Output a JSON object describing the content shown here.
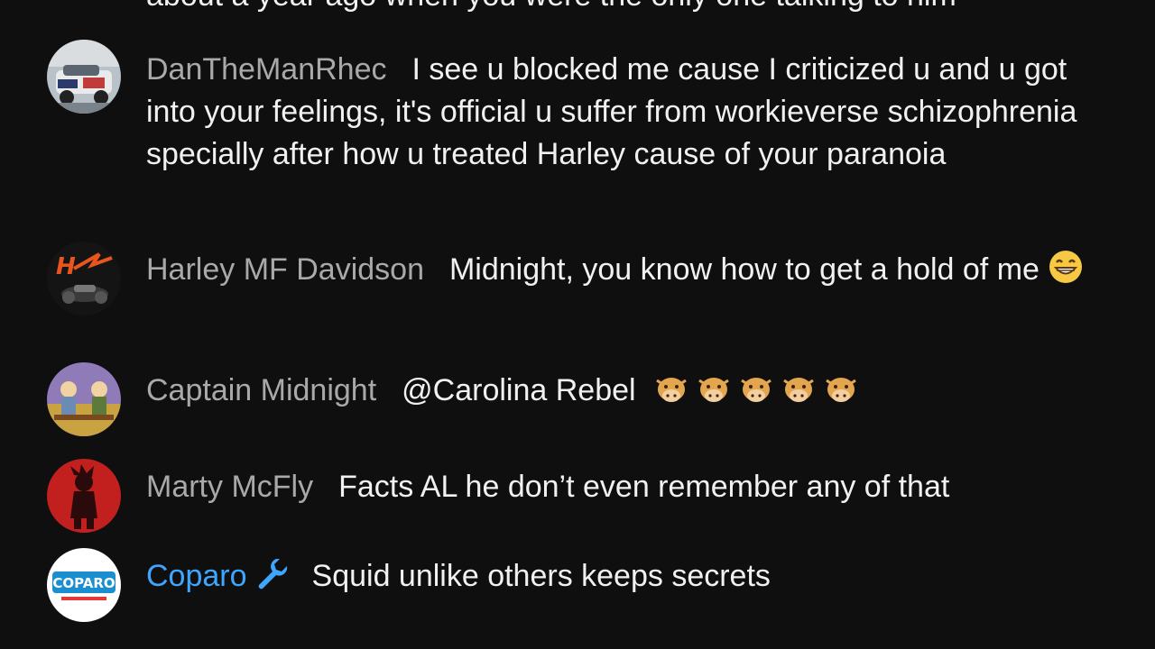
{
  "partial_line": "about a year ago when you were the only one talking to him",
  "messages": [
    {
      "author": "DanTheManRhec",
      "text": "I see u blocked me cause I criticized u and u got into your feelings, it's official u suffer from workieverse schizophrenia specially after how u treated Harley cause of your paranoia"
    },
    {
      "author": "Harley MF Davidson",
      "text": "Midnight, you know how to get a hold of me"
    },
    {
      "author": "Captain Midnight",
      "text": "@Carolina Rebel"
    },
    {
      "author": "Marty McFly",
      "text": "Facts AL he don’t even remember any of that"
    },
    {
      "author": "Coparo",
      "text": "Squid unlike others keeps secrets",
      "author_color": "#3ea6ff"
    }
  ],
  "icons": {
    "grin": "grinning-face-icon",
    "cow": "cow-face-icon",
    "wrench": "wrench-icon"
  },
  "avatars": {
    "coparo_logo": "COPARO"
  }
}
